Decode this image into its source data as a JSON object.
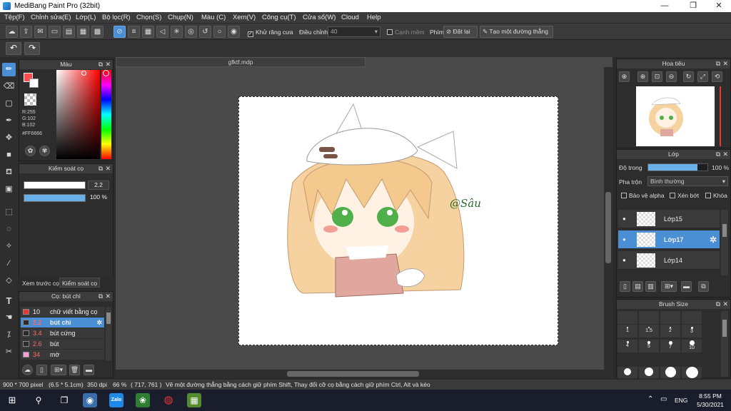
{
  "window": {
    "title": "MediBang Paint Pro (32bit)"
  },
  "menu": [
    "Tệp(F)",
    "Chỉnh sửa(E)",
    "Lớp(L)",
    "Bộ lọc(R)",
    "Chọn(S)",
    "Chụp(N)",
    "Màu (C)",
    "Xem(V)",
    "Công cụ(T)",
    "Cửa sổ(W)",
    "Cloud",
    "Help"
  ],
  "toolbar": {
    "antialias_label": "Khử răng cưa",
    "adjust_label": "Điều chỉnh",
    "adjust_value": "40",
    "snap_label": "Cạnh mềm",
    "key_label": "Phím",
    "reset_label": "Đặt lại",
    "create_line_label": "Tạo một đường thẳng"
  },
  "color_panel": {
    "title": "Màu",
    "r": "R:255",
    "g": "G:102",
    "b": "B:102",
    "hex": "#FF6666",
    "primary": "#ff4d4d"
  },
  "brush_control": {
    "title": "Kiểm soát cọ",
    "size_value": "2.2",
    "opacity_value": "100 %"
  },
  "panel_tabs": {
    "preview": "Xem trước cọ",
    "control": "Kiểm soát cọ"
  },
  "brush_panel": {
    "title": "Cọ: bút chì",
    "items": [
      {
        "size": "10",
        "name": "chữ viết bằng cọ",
        "color": "#e53935"
      },
      {
        "size": "2.2",
        "name": "bút chì",
        "color": "#2b2b2b"
      },
      {
        "size": "3.4",
        "name": "bút cứng",
        "color": "#2b2b2b"
      },
      {
        "size": "2.6",
        "name": "bút",
        "color": "#2b2b2b"
      },
      {
        "size": "34",
        "name": "mờ",
        "color": "#f5a0d8"
      }
    ]
  },
  "document": {
    "tab": "gfktf.mdp",
    "signature": "@Sâu"
  },
  "navigator": {
    "title": "Hoa tiêu"
  },
  "layer_panel": {
    "title": "Lớp",
    "opacity_label": "Độ trong",
    "opacity_value": "100 %",
    "opacity_fraction": 0.83,
    "blend_label": "Pha trộn",
    "blend_value": "Bình thường",
    "protect_alpha": "Bảo vệ alpha",
    "clipping": "Xén bớt",
    "lock": "Khóa",
    "layers": [
      {
        "name": "Lớp15",
        "selected": false
      },
      {
        "name": "Lớp17",
        "selected": true
      },
      {
        "name": "Lớp14",
        "selected": false
      }
    ]
  },
  "brush_size": {
    "title": "Brush Size",
    "labels": [
      "1",
      "1.5",
      "2",
      "3",
      "4",
      "5",
      "7",
      "10"
    ]
  },
  "status": {
    "dimensions": "900 * 700 pixel",
    "physical": "(6.5 * 5.1cm)",
    "dpi": "350 dpi",
    "zoom": "66 %",
    "cursor": "( 717, 761 )",
    "hint": "Vẽ một đường thẳng bằng cách giữ phím Shift, Thay đổi cỡ cọ bằng cách giữ phím Ctrl, Alt và kéo"
  },
  "taskbar": {
    "lang": "ENG",
    "time": "8:55 PM",
    "date": "5/30/2021",
    "zalo": "Zalo"
  }
}
